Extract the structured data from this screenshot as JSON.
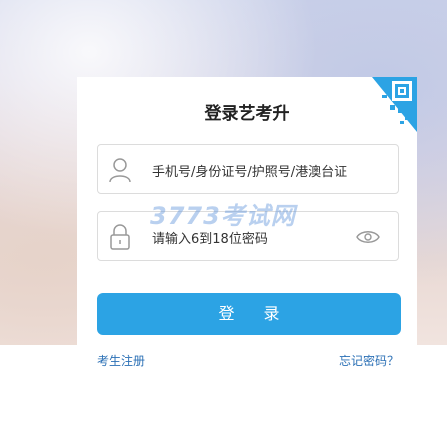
{
  "form": {
    "title": "登录艺考升",
    "account_placeholder": "手机号/身份证号/护照号/港澳台证",
    "password_placeholder": "请输入6到18位密码",
    "login_label": "登 录",
    "register_link": "考生注册",
    "forgot_link": "忘记密码？"
  },
  "watermark": "3773考试网",
  "colors": {
    "accent": "#2ca3e4",
    "link": "#2a6fb5",
    "qr": "#2ca3e4"
  },
  "icons": {
    "account": "user-icon",
    "password": "lock-icon",
    "toggle": "eye-icon",
    "corner": "qr-code-icon"
  }
}
